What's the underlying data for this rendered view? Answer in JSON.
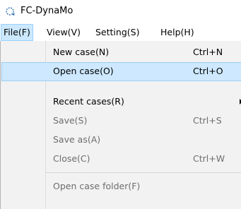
{
  "window": {
    "title": "FC-DynaMo"
  },
  "menubar": {
    "items": [
      {
        "label": "File(F)"
      },
      {
        "label": "View(V)"
      },
      {
        "label": "Setting(S)"
      },
      {
        "label": "Help(H)"
      }
    ]
  },
  "file_menu": {
    "items": [
      {
        "label": "New case(N)",
        "shortcut": "Ctrl+N"
      },
      {
        "label": "Open case(O)",
        "shortcut": "Ctrl+O"
      },
      {
        "label": "Recent cases(R)",
        "shortcut": ""
      },
      {
        "label": "Save(S)",
        "shortcut": "Ctrl+S"
      },
      {
        "label": "Save as(A)",
        "shortcut": ""
      },
      {
        "label": "Close(C)",
        "shortcut": "Ctrl+W"
      },
      {
        "label": "Open case folder(F)",
        "shortcut": ""
      }
    ]
  },
  "colors": {
    "menu_active_bg": "#cce8ff",
    "hover_row_bg": "#cde8ff",
    "disabled_text": "#6d6d6d"
  },
  "icons": [
    "app-icon",
    "submenu-arrow-icon"
  ]
}
